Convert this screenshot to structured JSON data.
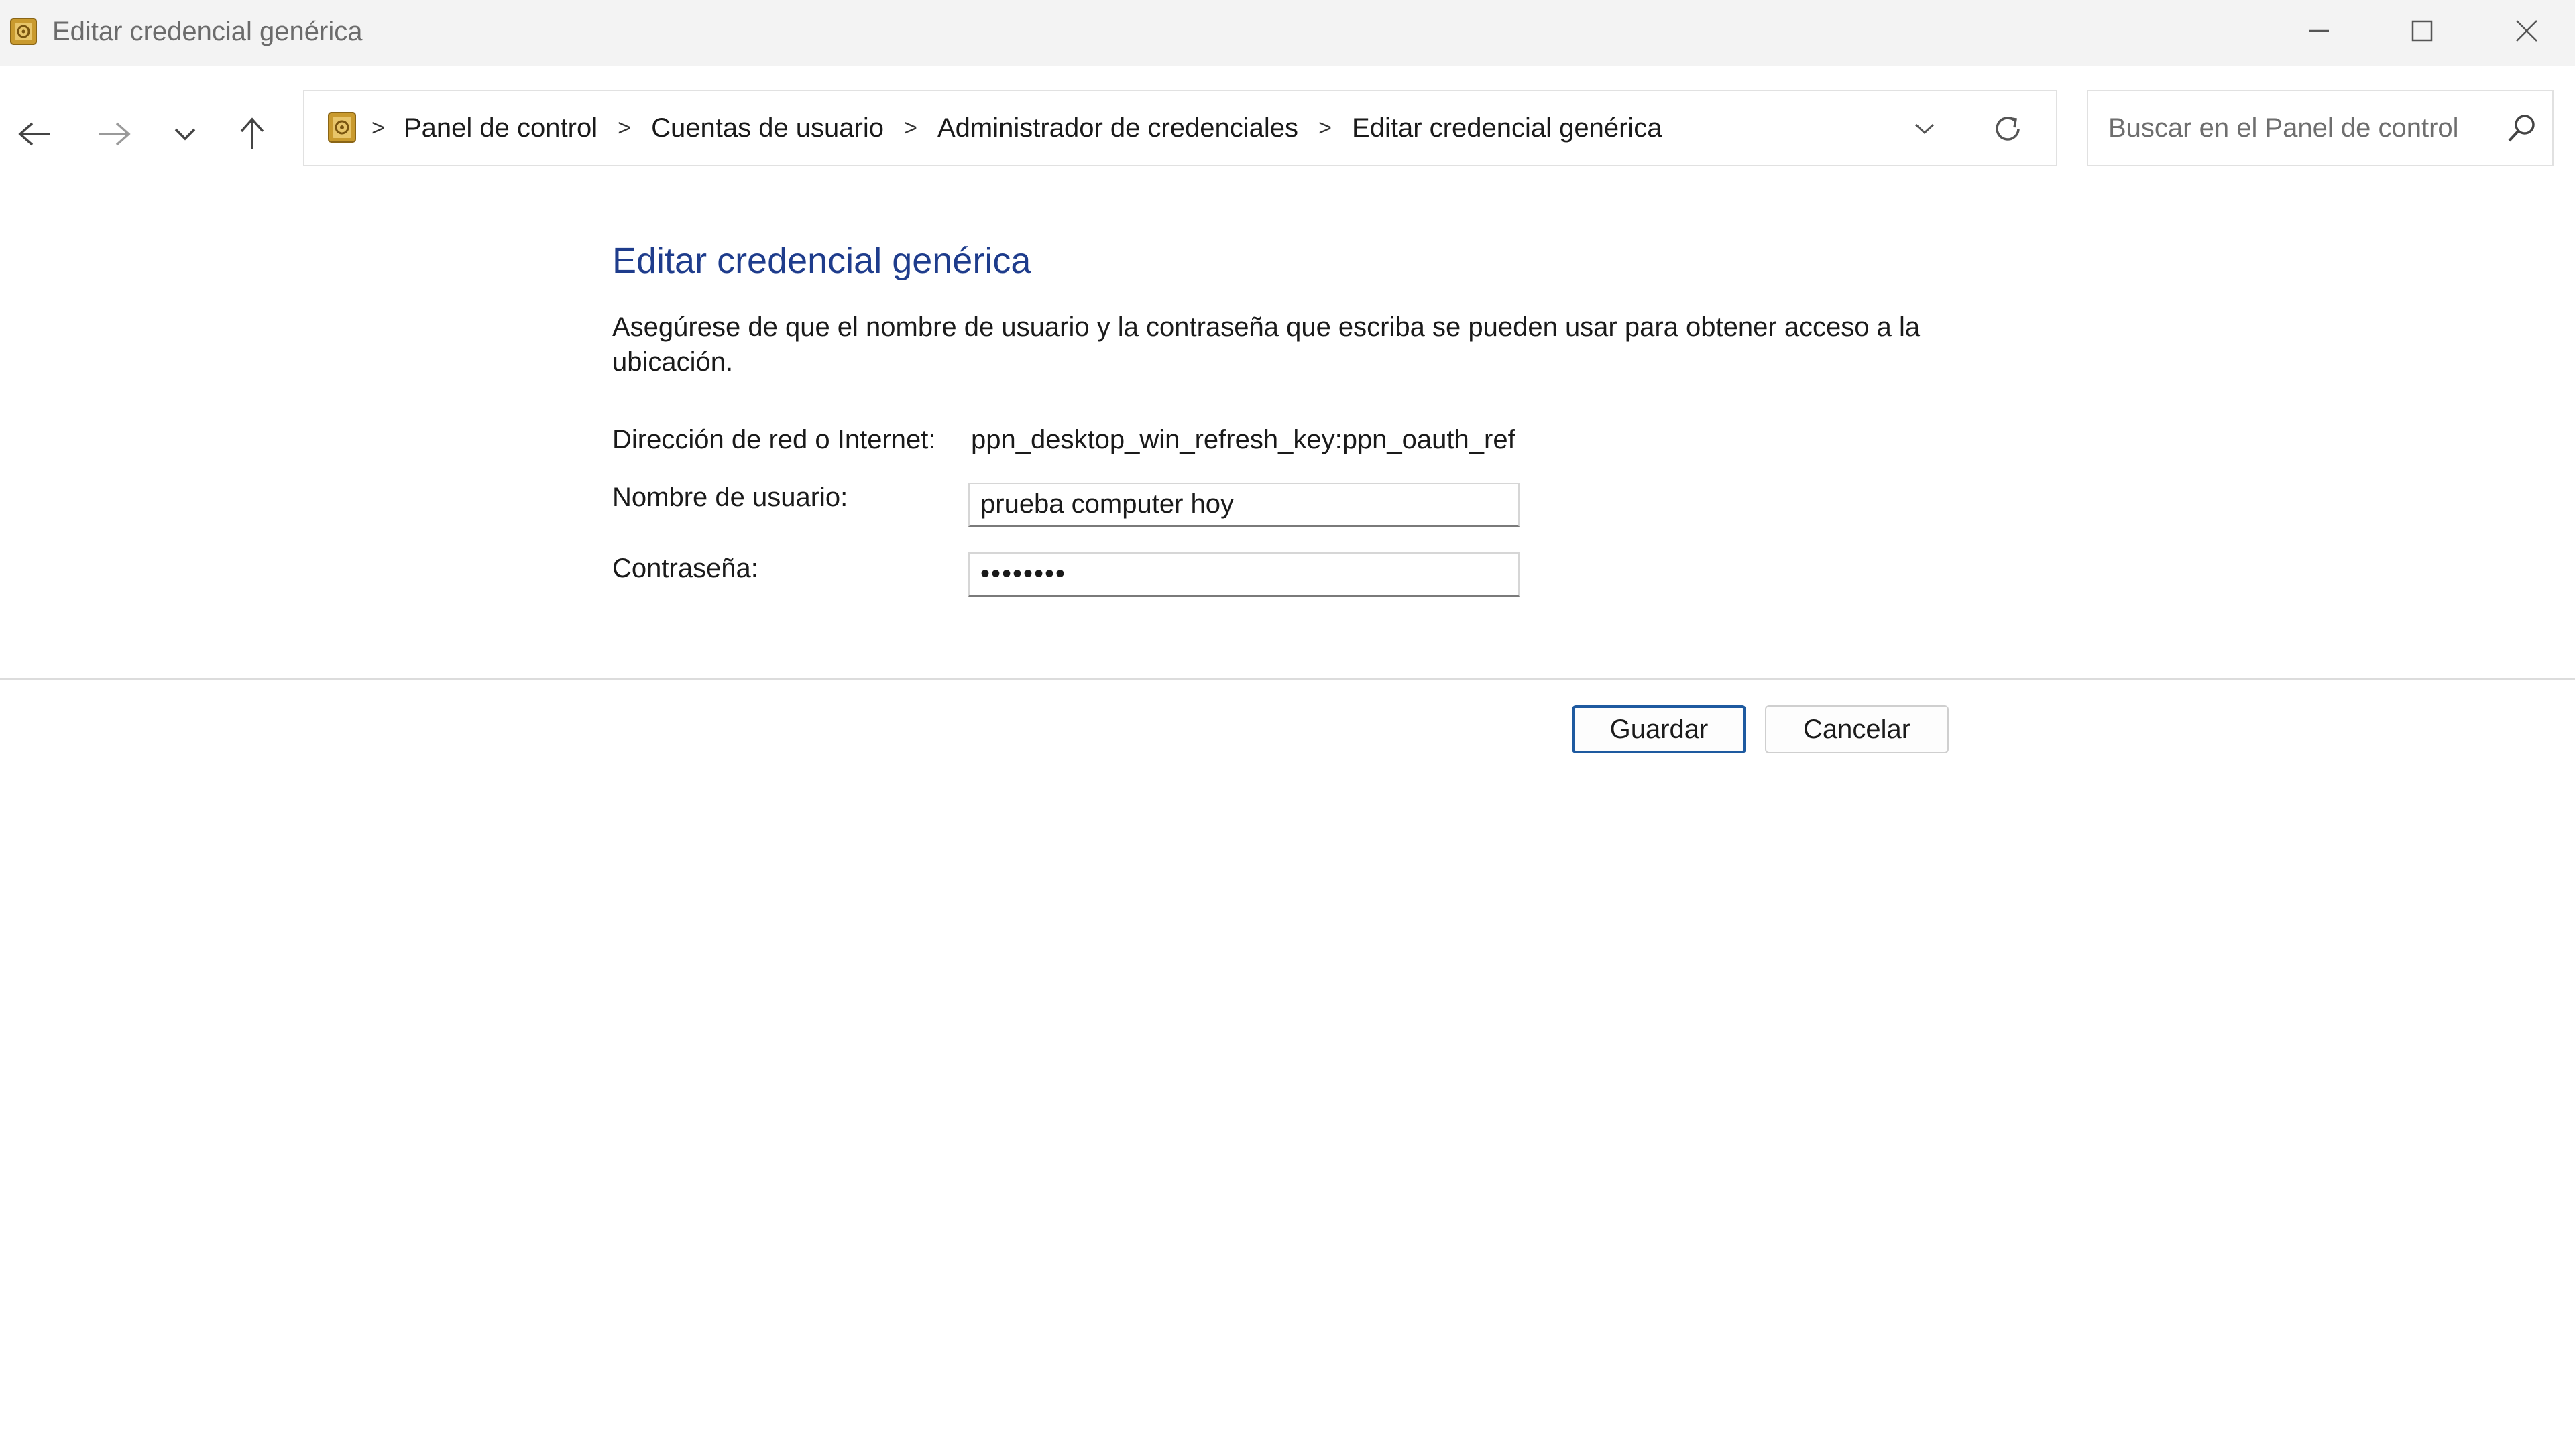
{
  "window": {
    "title": "Editar credencial genérica"
  },
  "toolbar": {
    "breadcrumbs": [
      "Panel de control",
      "Cuentas de usuario",
      "Administrador de credenciales",
      "Editar credencial genérica"
    ],
    "search_placeholder": "Buscar en el Panel de control"
  },
  "main": {
    "heading": "Editar credencial genérica",
    "description": "Asegúrese de que el nombre de usuario y la contraseña que escriba se pueden usar para obtener acceso a la ubicación.",
    "address_label": "Dirección de red o Internet:",
    "address_value": "ppn_desktop_win_refresh_key:ppn_oauth_ref",
    "username_label": "Nombre de usuario:",
    "username_value": "prueba computer hoy",
    "password_label": "Contraseña:",
    "password_value": "••••••••"
  },
  "buttons": {
    "save_label": "Guardar",
    "cancel_label": "Cancelar"
  },
  "colors": {
    "heading": "#1e3c8c",
    "accent_border": "#1e5aa0",
    "titlebar_bg": "#f3f3f3"
  }
}
